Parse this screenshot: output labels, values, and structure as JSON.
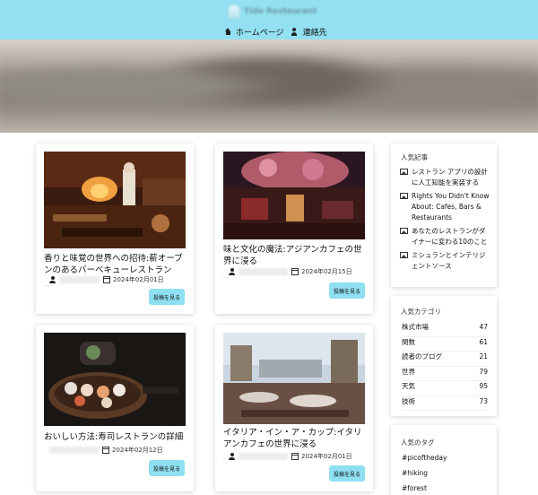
{
  "header": {
    "site_name": "Tido Restaurant",
    "nav": [
      {
        "label": "ホームページ",
        "icon": "home-icon"
      },
      {
        "label": "連絡先",
        "icon": "contact-icon"
      }
    ]
  },
  "posts": [
    {
      "title": "香りと味覚の世界への招待:薪オーブンのあるバーベキューレストラン",
      "date": "2024年02月01日",
      "button": "投稿を見る"
    },
    {
      "title": "味と文化の魔法:アジアンカフェの世界に浸る",
      "date": "2024年02月15日",
      "button": "投稿を見る"
    },
    {
      "title": "おいしい方法:寿司レストランの詳細",
      "date": "2024年02月12日",
      "button": "投稿を見る"
    },
    {
      "title": "イタリア・イン・ア・カップ:イタリアンカフェの世界に浸る",
      "date": "2024年02月01日",
      "button": "投稿を見る"
    }
  ],
  "sidebar": {
    "popular_posts": {
      "heading": "人気記事",
      "items": [
        "レストラン アプリの設計に人工知能を実装する",
        "Rights You Didn't Know About: Cafes, Bars & Restaurants",
        "あなたのレストランがダイナーに変わる10のこと",
        "ミシュランとインテリジェントソース"
      ]
    },
    "categories": {
      "heading": "人気カテゴリ",
      "items": [
        {
          "name": "株式市場",
          "count": "47"
        },
        {
          "name": "関数",
          "count": "61"
        },
        {
          "name": "読者のブログ",
          "count": "21"
        },
        {
          "name": "世界",
          "count": "79"
        },
        {
          "name": "天気",
          "count": "95"
        },
        {
          "name": "技術",
          "count": "73"
        }
      ]
    },
    "tags": {
      "heading": "人気のタグ",
      "items": [
        "#picoftheday",
        "#hiking",
        "#forest"
      ]
    }
  }
}
